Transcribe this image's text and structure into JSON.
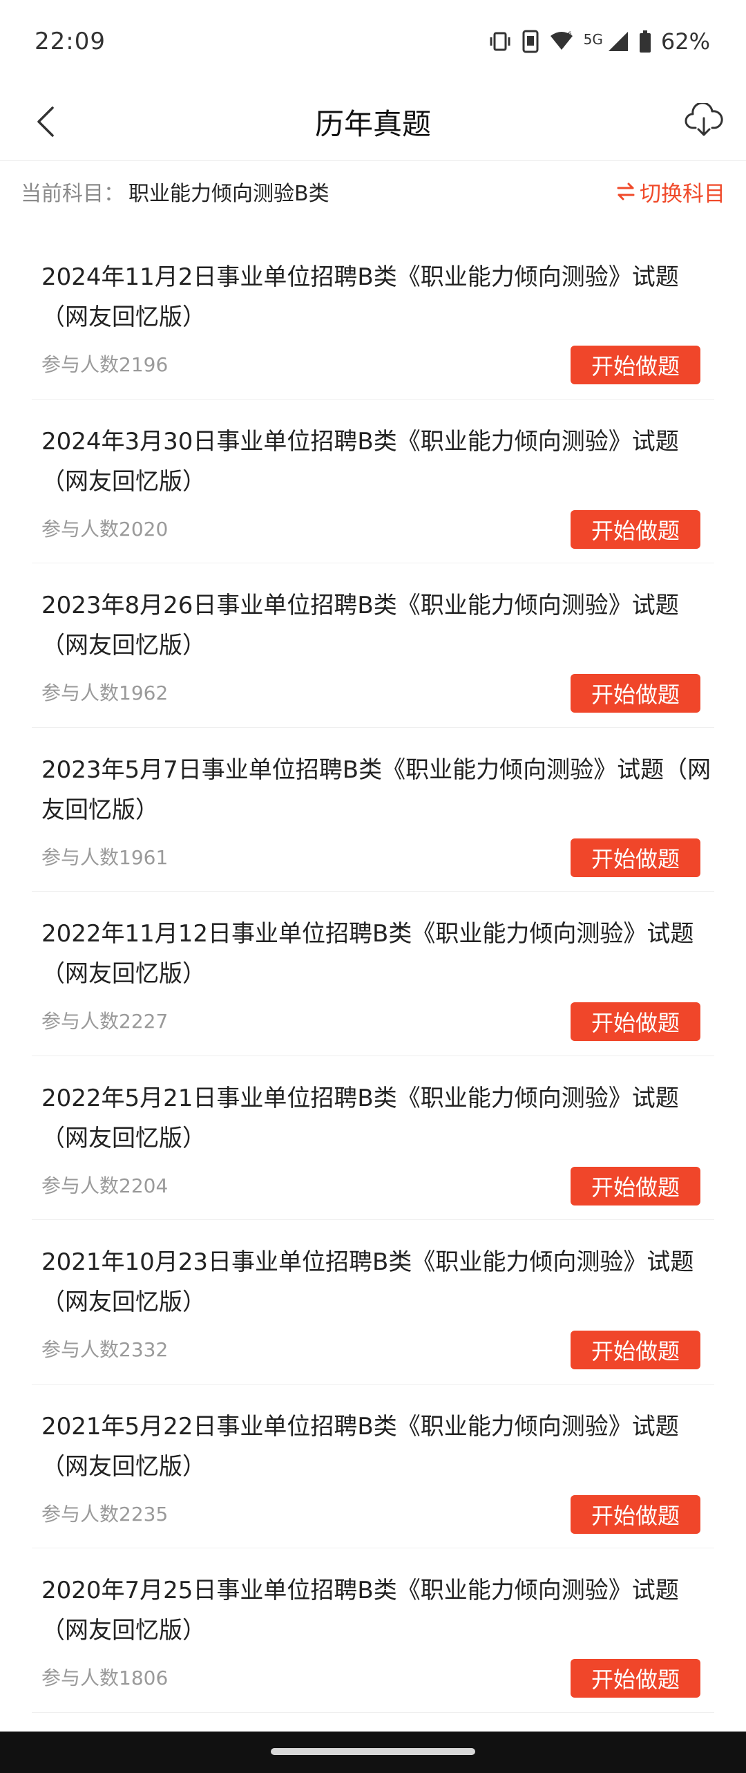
{
  "status": {
    "time": "22:09",
    "battery": "62%",
    "network": "5G"
  },
  "header": {
    "title": "历年真题"
  },
  "subject": {
    "label": "当前科目：",
    "value": "职业能力倾向测验B类",
    "switch_label": "切换科目"
  },
  "exams": [
    {
      "title": "2024年11月2日事业单位招聘B类《职业能力倾向测验》试题（网友回忆版）",
      "count": "参与人数2196",
      "button": "开始做题"
    },
    {
      "title": "2024年3月30日事业单位招聘B类《职业能力倾向测验》试题（网友回忆版）",
      "count": "参与人数2020",
      "button": "开始做题"
    },
    {
      "title": "2023年8月26日事业单位招聘B类《职业能力倾向测验》试题（网友回忆版）",
      "count": "参与人数1962",
      "button": "开始做题"
    },
    {
      "title": "2023年5月7日事业单位招聘B类《职业能力倾向测验》试题（网友回忆版）",
      "count": "参与人数1961",
      "button": "开始做题"
    },
    {
      "title": "2022年11月12日事业单位招聘B类《职业能力倾向测验》试题（网友回忆版）",
      "count": "参与人数2227",
      "button": "开始做题"
    },
    {
      "title": "2022年5月21日事业单位招聘B类《职业能力倾向测验》试题（网友回忆版）",
      "count": "参与人数2204",
      "button": "开始做题"
    },
    {
      "title": "2021年10月23日事业单位招聘B类《职业能力倾向测验》试题（网友回忆版）",
      "count": "参与人数2332",
      "button": "开始做题"
    },
    {
      "title": "2021年5月22日事业单位招聘B类《职业能力倾向测验》试题（网友回忆版）",
      "count": "参与人数2235",
      "button": "开始做题"
    },
    {
      "title": "2020年7月25日事业单位招聘B类《职业能力倾向测验》试题（网友回忆版）",
      "count": "参与人数1806",
      "button": "开始做题"
    }
  ],
  "icons": {
    "back": "back-arrow-icon",
    "cloud": "cloud-download-icon",
    "switch": "swap-arrows-icon"
  },
  "colors": {
    "accent": "#f0462a",
    "text": "#222222",
    "muted": "#9a9a9a"
  }
}
